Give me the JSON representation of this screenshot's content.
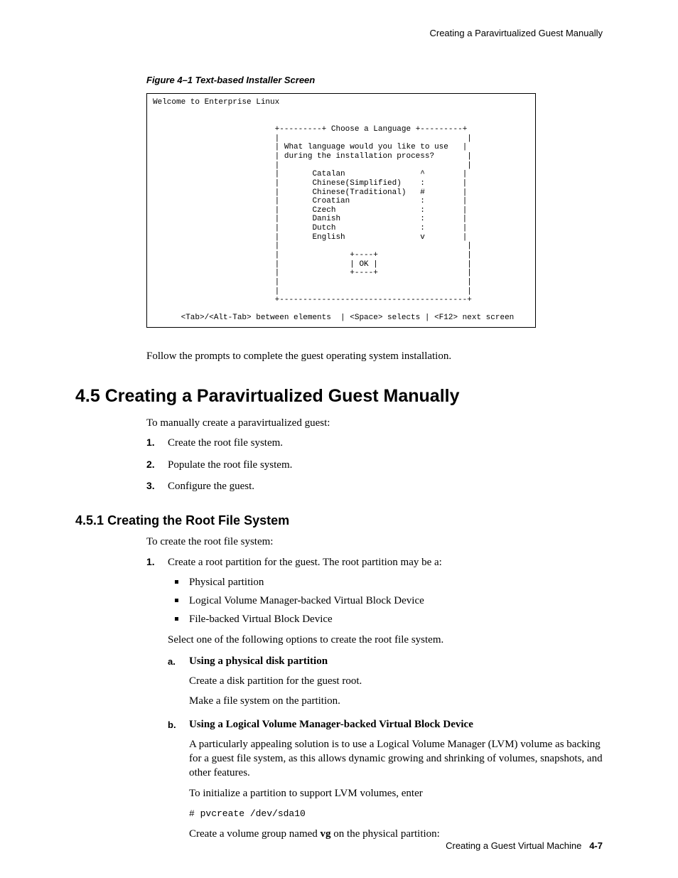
{
  "running_head": "Creating a Paravirtualized Guest Manually",
  "figure_caption": "Figure 4–1   Text-based Installer Screen",
  "installer": {
    "welcome": "Welcome to Enterprise Linux",
    "title_rule_left": "+---------+",
    "title": "Choose a Language",
    "title_rule_right": "+---------+",
    "prompt1": "What language would you like to use",
    "prompt2": "during the installation process?",
    "langs": [
      {
        "name": "Catalan",
        "mark": "^"
      },
      {
        "name": "Chinese(Simplified)",
        "mark": ":"
      },
      {
        "name": "Chinese(Traditional)",
        "mark": "#"
      },
      {
        "name": "Croatian",
        "mark": ":"
      },
      {
        "name": "Czech",
        "mark": ":"
      },
      {
        "name": "Danish",
        "mark": ":"
      },
      {
        "name": "Dutch",
        "mark": ":"
      },
      {
        "name": "English",
        "mark": "v"
      }
    ],
    "btn_top": "+----+",
    "btn_mid": "| OK |",
    "btn_bot": "+----+",
    "bottom_rule": "+----------------------------------------+",
    "help": "<Tab>/<Alt-Tab> between elements  | <Space> selects | <F12> next screen"
  },
  "after_figure": "Follow the prompts to complete the guest operating system installation.",
  "section": {
    "number": "4.5",
    "title": "Creating a Paravirtualized Guest Manually",
    "intro": "To manually create a paravirtualized guest:",
    "steps": [
      "Create the root file system.",
      "Populate the root file system.",
      "Configure the guest."
    ]
  },
  "subsection": {
    "number": "4.5.1",
    "title": "Creating the Root File System",
    "intro": "To create the root file system:",
    "step1_intro": "Create a root partition for the guest. The root partition may be a:",
    "bullets": [
      "Physical partition",
      "Logical Volume Manager-backed Virtual Block Device",
      "File-backed Virtual Block Device"
    ],
    "select_text": "Select one of the following options to create the root file system.",
    "a": {
      "heading": "Using a physical disk partition",
      "p1": "Create a disk partition for the guest root.",
      "p2": "Make a file system on the partition."
    },
    "b": {
      "heading": "Using a Logical Volume Manager-backed Virtual Block Device",
      "p1": "A particularly appealing solution is to use a Logical Volume Manager (LVM) volume as backing for a guest file system, as this allows dynamic growing and shrinking of volumes, snapshots, and other features.",
      "p2": "To initialize a partition to support LVM volumes, enter",
      "code": "# pvcreate /dev/sda10",
      "p3_pre": "Create a volume group named ",
      "p3_bold": "vg",
      "p3_post": " on the physical partition:"
    }
  },
  "footer": {
    "text": "Creating a Guest Virtual Machine",
    "page": "4-7"
  }
}
